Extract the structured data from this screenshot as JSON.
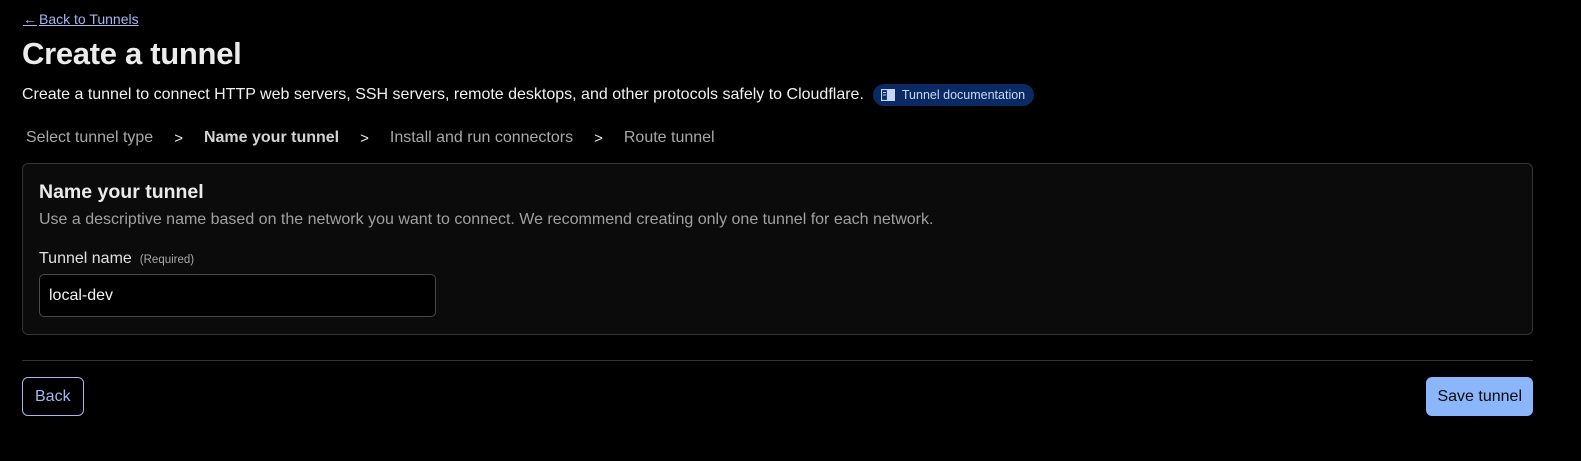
{
  "nav": {
    "back_arrow": "←",
    "back_label": "Back to Tunnels"
  },
  "header": {
    "title": "Create a tunnel",
    "subtitle": "Create a tunnel to connect HTTP web servers, SSH servers, remote desktops, and other protocols safely to Cloudflare.",
    "doc_badge_label": "Tunnel documentation",
    "doc_badge_icon": "book-icon"
  },
  "steps": {
    "separator": ">",
    "items": [
      {
        "label": "Select tunnel type",
        "active": false
      },
      {
        "label": "Name your tunnel",
        "active": true
      },
      {
        "label": "Install and run connectors",
        "active": false
      },
      {
        "label": "Route tunnel",
        "active": false
      }
    ]
  },
  "card": {
    "title": "Name your tunnel",
    "description": "Use a descriptive name based on the network you want to connect. We recommend creating only one tunnel for each network.",
    "field_label": "Tunnel name",
    "field_required": "(Required)",
    "field_value": "local-dev"
  },
  "footer": {
    "back_label": "Back",
    "save_label": "Save tunnel"
  },
  "colors": {
    "background": "#000000",
    "link": "#a3b7f0",
    "primary_button": "#8bb6fb",
    "badge_bg": "#0b2a63"
  }
}
